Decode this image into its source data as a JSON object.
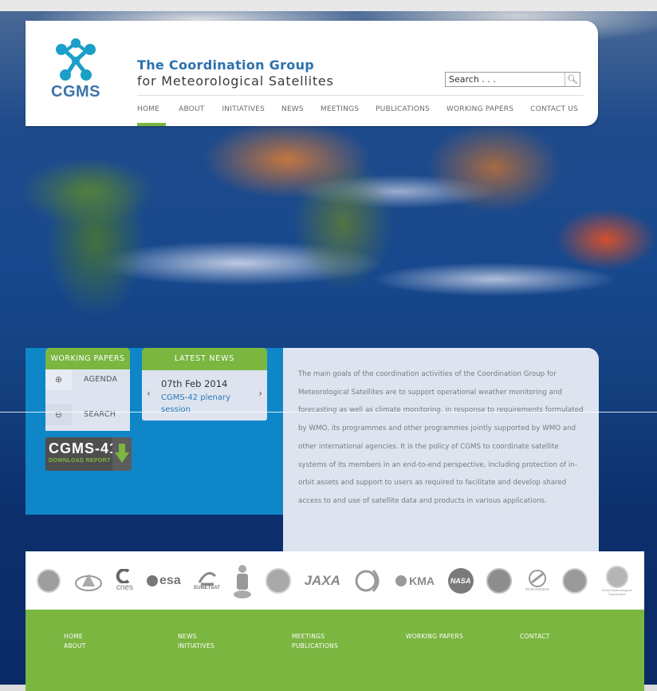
{
  "header": {
    "logo_text": "CGMS",
    "title_line1": "The Coordination Group",
    "title_line2": "for Meteorological Satellites",
    "search_placeholder": "Search . . .",
    "nav": [
      "HOME",
      "ABOUT",
      "INITIATIVES",
      "NEWS",
      "MEETINGS",
      "PUBLICATIONS",
      "WORKING PAPERS",
      "CONTACT US"
    ],
    "active_nav": "HOME"
  },
  "working_papers": {
    "tab": "WORKING PAPERS",
    "items": [
      {
        "icon": "zoom-icon",
        "label": "AGENDA"
      },
      {
        "icon": "search-doc-icon",
        "label": "SEARCH"
      }
    ]
  },
  "latest_news": {
    "tab": "LATEST NEWS",
    "date": "07th Feb 2014",
    "link": "CGMS-42 plenary session"
  },
  "report": {
    "title": "CGMS-41",
    "subtitle": "DOWNLOAD REPORT"
  },
  "description": "The main goals of the coordination activities of the Coordination Group for Meteorological Satellites are to support operational weather monitoring and forecasting as well as climate monitoring, in response to requirements formulated by WMO, its programmes and other programmes jointly supported by WMO and other international agencies. It is the policy of CGMS to coordinate satellite systems of its members in an end-to-end perspective, including protection of in-orbit assets and support to users as required to facilitate and develop shared access to and use of satellite data and products in various applications.",
  "partner_logos": {
    "cnes": "cnes",
    "esa": "esa",
    "eumetsat": "EUMETSAT",
    "jaxa": "JAXA",
    "kma": "KMA",
    "nasa": "NASA",
    "roscosmos": "ROSCOSMOS",
    "wmo": "World Meteorological Organization"
  },
  "footer": {
    "col1": [
      "HOME",
      "ABOUT"
    ],
    "col2": [
      "NEWS",
      "INITIATIVES"
    ],
    "col3": [
      "MEETINGS",
      "PUBLICATIONS"
    ],
    "col4": [
      "WORKING PAPERS"
    ],
    "col5": [
      "CONTACT"
    ]
  },
  "colors": {
    "accent_green": "#7ab640",
    "panel_blue": "#0f86c8",
    "title_blue": "#2b71ad",
    "panel_light": "#dde4f0"
  }
}
